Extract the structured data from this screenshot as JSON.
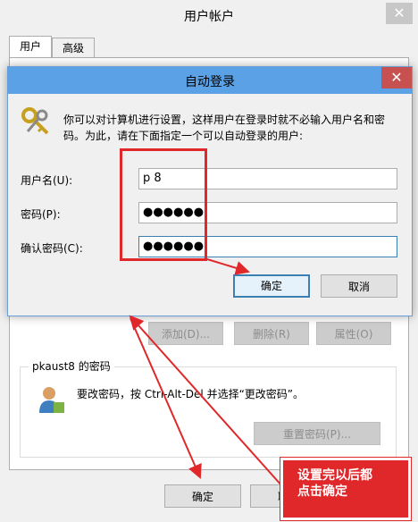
{
  "window": {
    "title": "用户帐户",
    "close_glyph": "✕",
    "tabs": [
      {
        "label": "用户",
        "active": true
      },
      {
        "label": "高级",
        "active": false
      }
    ],
    "actions": {
      "add": "添加(D)...",
      "remove": "删除(R)",
      "properties": "属性(O)"
    },
    "password_group": {
      "legend": "pkaust8 的密码",
      "instruction": "要改密码，按 Ctrl-Alt-Del 并选择“更改密码”。",
      "reset": "重置密码(P)..."
    },
    "ok": "确定",
    "cancel": "取消"
  },
  "dialog": {
    "title": "自动登录",
    "close_glyph": "✕",
    "description_line1": "你可以对计算机进行设置，这样用户在登录时就不必输入用户名和密",
    "description_line2": "码。为此，请在下面指定一个可以自动登录的用户:",
    "username_label": "用户名(U):",
    "username_value": "p        8",
    "password_label": "密码(P):",
    "password_value": "●●●●●●",
    "confirm_label": "确认密码(C):",
    "confirm_value": "●●●●●●",
    "ok": "确定",
    "cancel": "取消"
  },
  "annotation": {
    "line1": "设置完以后都",
    "line2": "点击确定",
    "color": "#e0282b"
  }
}
